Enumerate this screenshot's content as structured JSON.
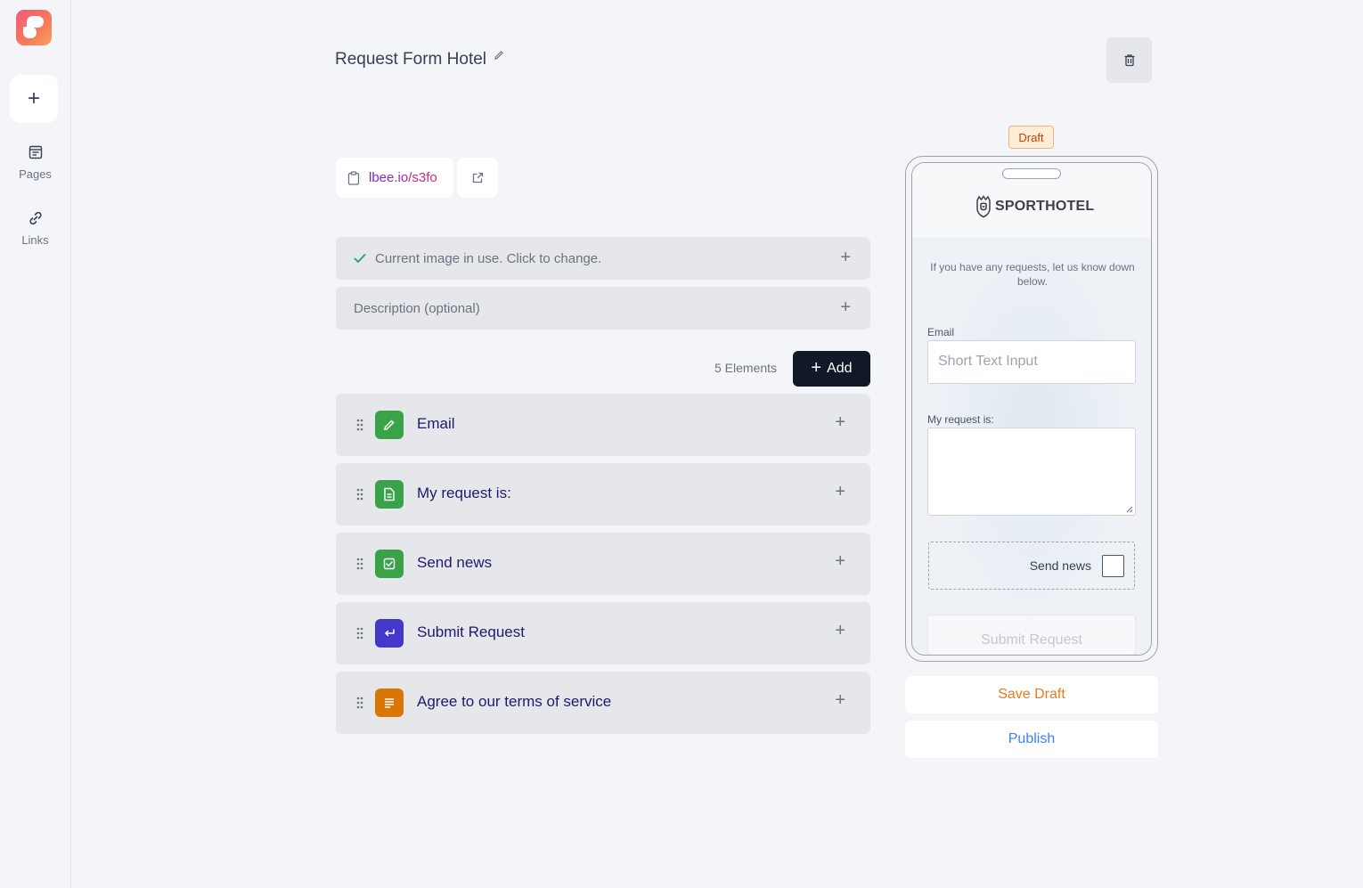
{
  "sidebar": {
    "new_label": "+",
    "items": [
      {
        "label": "Pages",
        "icon": "pages-icon"
      },
      {
        "label": "Links",
        "icon": "link-icon"
      }
    ]
  },
  "header": {
    "title": "Request Form Hotel"
  },
  "link": {
    "url": "lbee.io/s3fo"
  },
  "bars": {
    "image": "Current image in use. Click to change.",
    "description_placeholder": "Description (optional)"
  },
  "elements": {
    "count_label": "5 Elements",
    "add_label": "Add",
    "items": [
      {
        "label": "Email",
        "type": "short-text",
        "color": "#3aa34a"
      },
      {
        "label": "My request is:",
        "type": "long-text",
        "color": "#3aa34a"
      },
      {
        "label": "Send news",
        "type": "checkbox",
        "color": "#3aa34a"
      },
      {
        "label": "Submit Request",
        "type": "submit",
        "color": "#4338ca"
      },
      {
        "label": "Agree to our terms of service",
        "type": "terms",
        "color": "#d97706"
      }
    ]
  },
  "preview": {
    "status": "Draft",
    "brand": "SPORTHOTEL",
    "description": "If you have any requests, let us know down below.",
    "email_label": "Email",
    "email_placeholder": "Short Text Input",
    "request_label": "My request is:",
    "checkbox_label": "Send news",
    "submit_label": "Submit Request"
  },
  "actions": {
    "save_draft": "Save Draft",
    "publish": "Publish"
  },
  "colors": {
    "accent_orange": "#ea7a1a",
    "accent_blue": "#3b82f6",
    "dark": "#111827"
  }
}
